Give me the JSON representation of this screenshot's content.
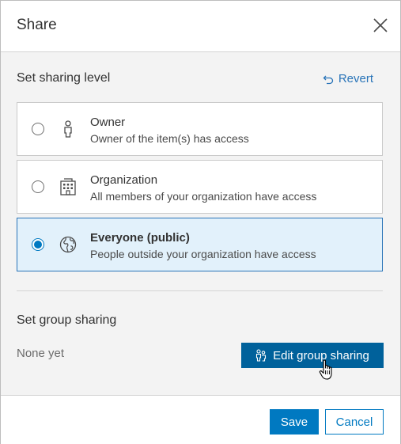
{
  "dialog": {
    "title": "Share",
    "close_icon": "close-icon"
  },
  "sharing_level": {
    "title": "Set sharing level",
    "revert_label": "Revert",
    "revert_icon": "undo-icon",
    "options": [
      {
        "title": "Owner",
        "description": "Owner of the item(s) has access",
        "icon": "person-icon",
        "selected": false
      },
      {
        "title": "Organization",
        "description": "All members of your organization have access",
        "icon": "building-icon",
        "selected": false
      },
      {
        "title": "Everyone (public)",
        "description": "People outside your organization have access",
        "icon": "globe-icon",
        "selected": true
      }
    ]
  },
  "group_sharing": {
    "title": "Set group sharing",
    "status": "None yet",
    "edit_label": "Edit group sharing",
    "edit_icon": "group-icon"
  },
  "footer": {
    "save_label": "Save",
    "cancel_label": "Cancel"
  },
  "colors": {
    "accent": "#0079c1",
    "accent_dark": "#00619b",
    "selected_bg": "#e2f1fb",
    "panel_bg": "#f3f3f3"
  }
}
